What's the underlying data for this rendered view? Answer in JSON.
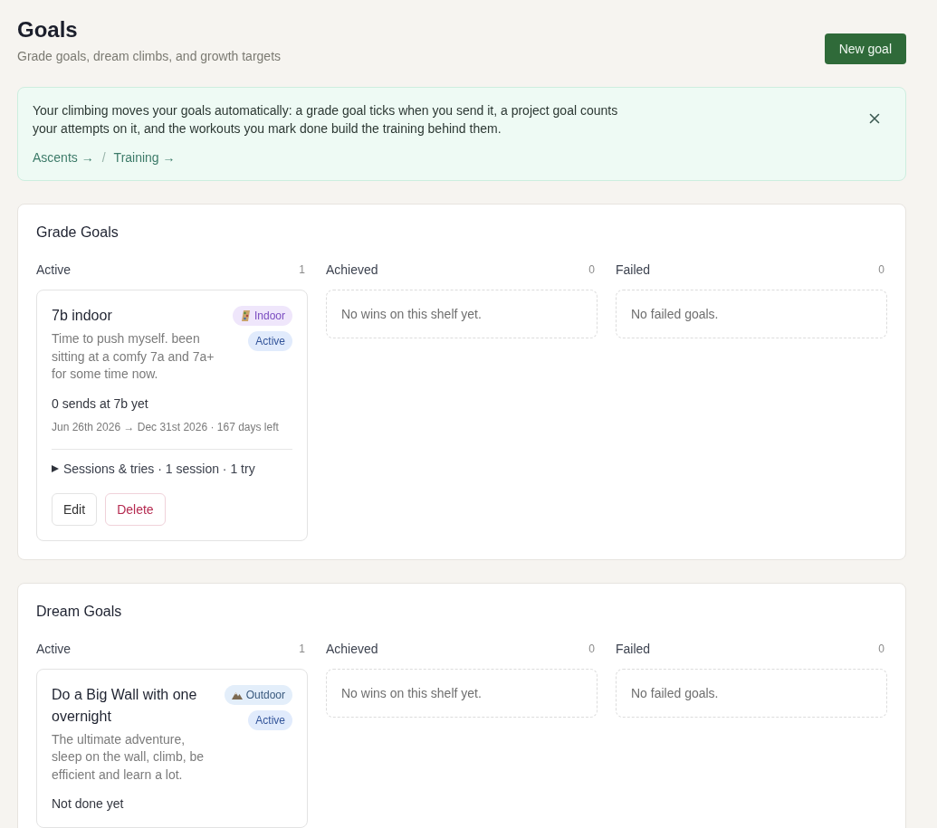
{
  "header": {
    "title": "Goals",
    "subtitle": "Grade goals, dream climbs, and growth targets",
    "new_goal_button": "New goal"
  },
  "banner": {
    "text": "Your climbing moves your goals automatically: a grade goal ticks when you send it, a project goal counts your attempts on it, and the workouts you mark done build the training behind them.",
    "links": [
      "Ascents →",
      "Training →"
    ],
    "separator": "/"
  },
  "sections": [
    {
      "title": "Grade Goals",
      "columns": [
        {
          "title": "Active",
          "count": "1",
          "goals": [
            {
              "title": "7b indoor",
              "badges": [
                {
                  "kind": "indoor",
                  "label": "Indoor"
                },
                {
                  "kind": "status",
                  "label": "Active"
                }
              ],
              "description": "Time to push myself. been sitting at a comfy 7a and 7a+ for some time now.",
              "summary": "0 sends at 7b yet",
              "dates": "Jun 26th 2026 → Dec 31st 2026 · 167 days left",
              "sessions": {
                "label": "Sessions & tries · 1 session · 1 try",
                "expanded": false
              },
              "actions": [
                {
                  "kind": "edit",
                  "label": "Edit"
                },
                {
                  "kind": "delete",
                  "label": "Delete"
                }
              ]
            }
          ]
        },
        {
          "title": "Achieved",
          "count": "0",
          "empty_text": "No wins on this shelf yet."
        },
        {
          "title": "Failed",
          "count": "0",
          "empty_text": "No failed goals."
        }
      ]
    },
    {
      "title": "Dream Goals",
      "columns": [
        {
          "title": "Active",
          "count": "1",
          "goals": [
            {
              "title": "Do a Big Wall with one overnight",
              "badges": [
                {
                  "kind": "outdoor",
                  "label": "Outdoor"
                },
                {
                  "kind": "status",
                  "label": "Active"
                }
              ],
              "description": "The ultimate adventure, sleep on the wall, climb, be efficient and learn a lot.",
              "summary": "Not done yet"
            }
          ]
        },
        {
          "title": "Achieved",
          "count": "0",
          "empty_text": "No wins on this shelf yet."
        },
        {
          "title": "Failed",
          "count": "0",
          "empty_text": "No failed goals."
        }
      ]
    }
  ]
}
